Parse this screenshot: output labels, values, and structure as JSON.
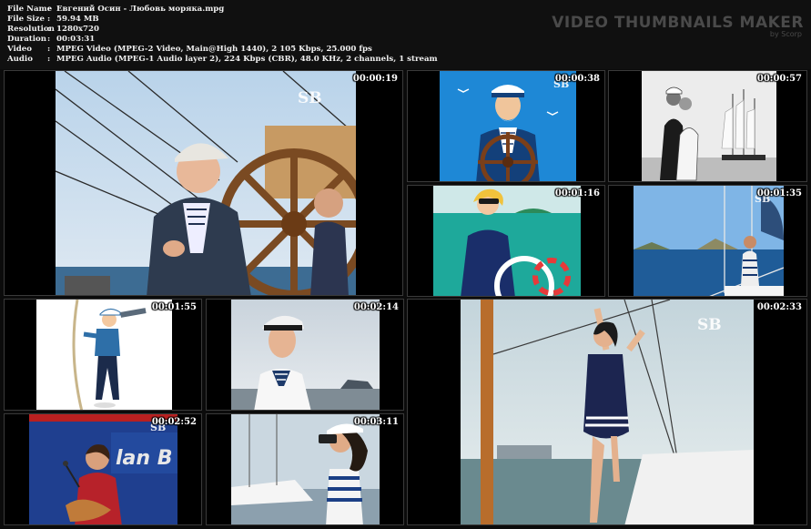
{
  "file_info": [
    {
      "label": "File Name",
      "value": "Евгений Осин - Любовь моряка.mpg"
    },
    {
      "label": "File Size",
      "value": "59.94 MB"
    },
    {
      "label": "Resolution",
      "value": "1280x720"
    },
    {
      "label": "Duration",
      "value": "00:03:31"
    },
    {
      "label": "Video",
      "value": "MPEG Video (MPEG-2 Video, Main@High 1440), 2 105 Kbps, 25.000 fps"
    },
    {
      "label": "Audio",
      "value": "MPEG Audio (MPEG-1 Audio layer 2), 224 Kbps (CBR), 48.0 KHz, 2 channels, 1 stream"
    }
  ],
  "separator": ":",
  "brand": {
    "title": "VIDEO THUMBNAILS MAKER",
    "subtitle": "by Scorp"
  },
  "watermark": "SB",
  "thumbnails": [
    {
      "time": "00:00:19",
      "subject": "young-sailor-at-ship-wheel"
    },
    {
      "time": "00:00:38",
      "subject": "cartoon-captain-at-wheel"
    },
    {
      "time": "00:00:57",
      "subject": "sailor-kiss-tall-ship"
    },
    {
      "time": "00:01:16",
      "subject": "cartoon-sailor-woman"
    },
    {
      "time": "00:01:35",
      "subject": "sailor-on-yacht"
    },
    {
      "time": "00:01:55",
      "subject": "cartoon-sailor-telescope"
    },
    {
      "time": "00:02:14",
      "subject": "sailor-in-cap"
    },
    {
      "time": "00:02:33",
      "subject": "woman-on-yacht-mast"
    },
    {
      "time": "00:02:52",
      "subject": "singer-with-guitar"
    },
    {
      "time": "00:03:11",
      "subject": "woman-with-binoculars"
    }
  ]
}
